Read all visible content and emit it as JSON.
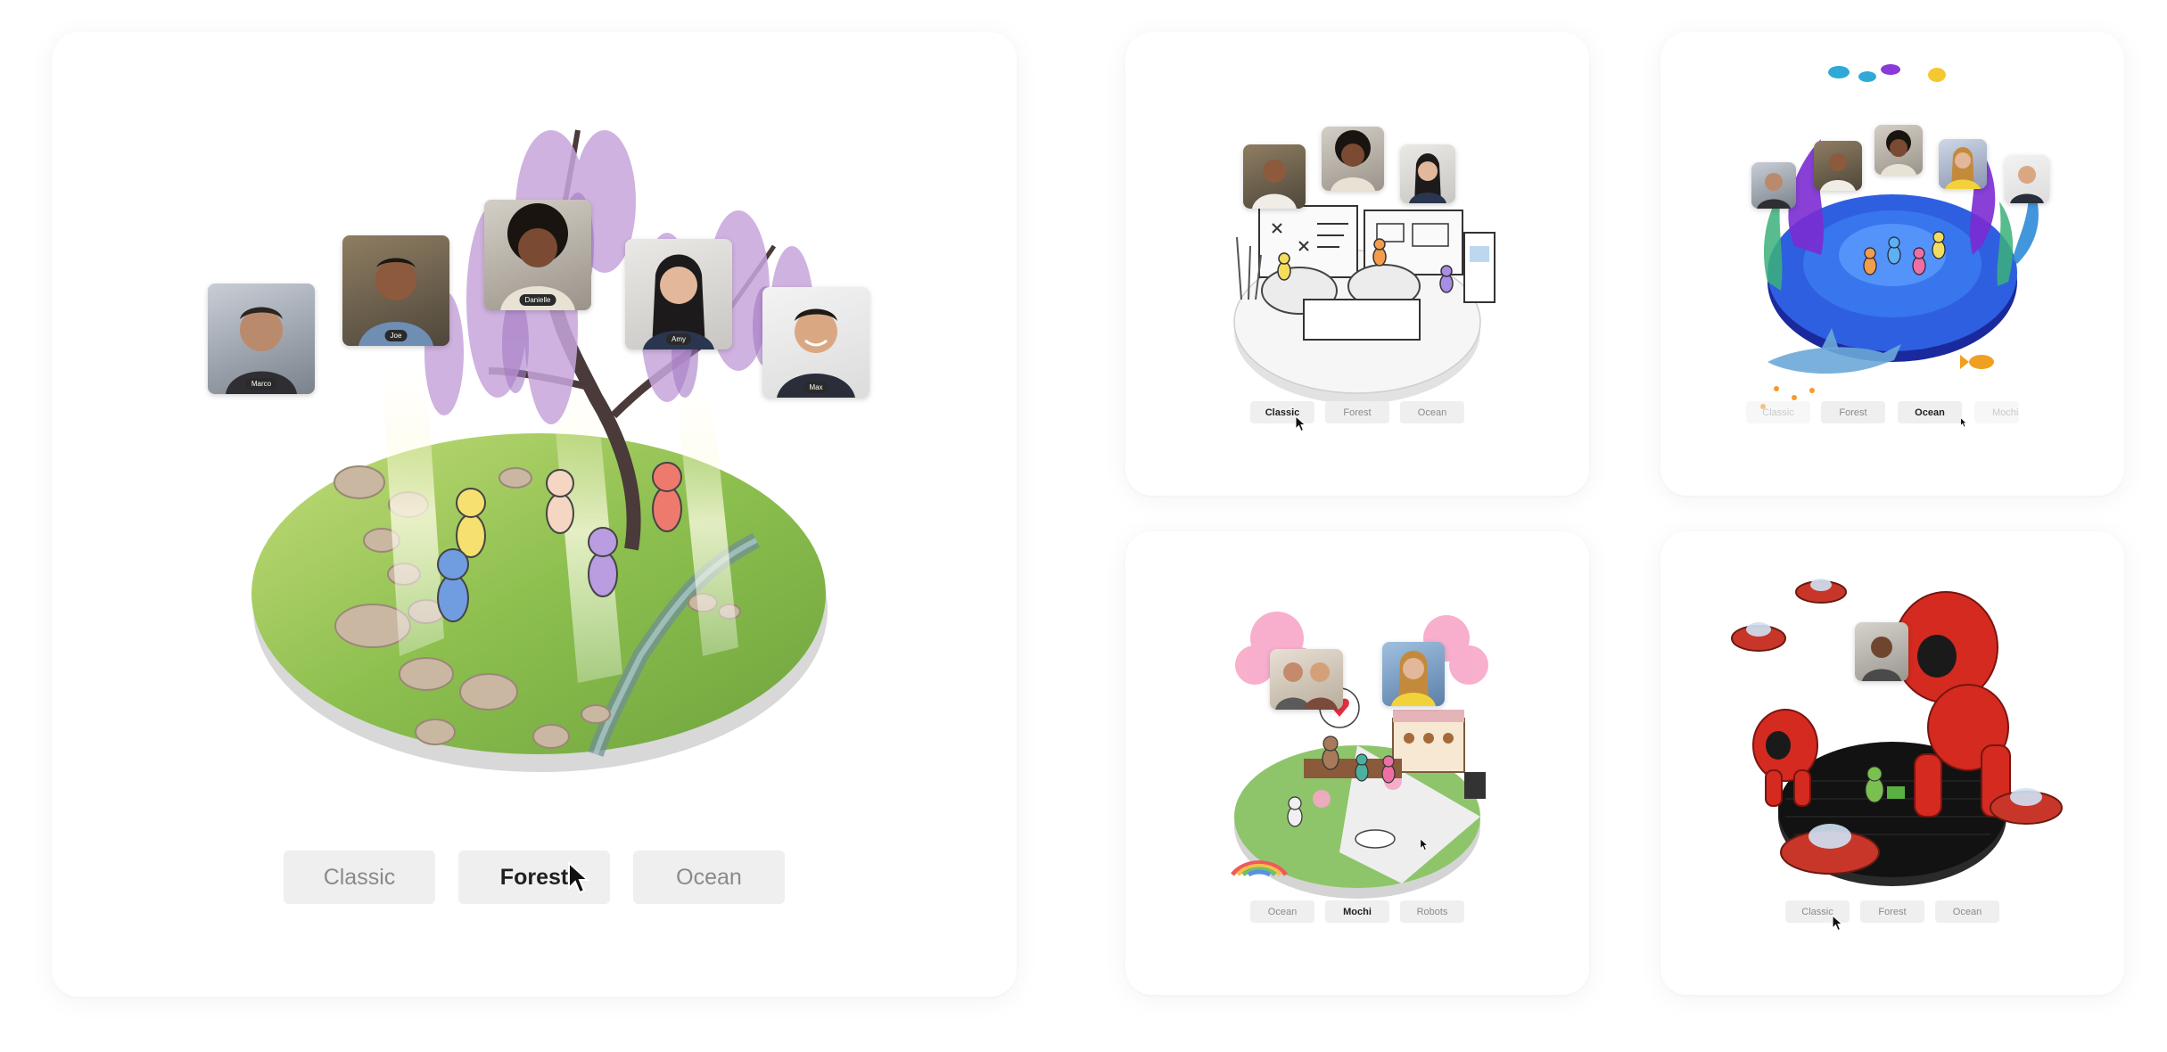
{
  "main_card": {
    "buttons": [
      {
        "label": "Classic",
        "active": false
      },
      {
        "label": "Forest",
        "active": true
      },
      {
        "label": "Ocean",
        "active": false
      }
    ],
    "participants": [
      "Marco",
      "Joe",
      "Danielle",
      "Amy",
      "Max"
    ]
  },
  "classic_card": {
    "buttons": [
      {
        "label": "Classic",
        "active": true
      },
      {
        "label": "Forest",
        "active": false
      },
      {
        "label": "Ocean",
        "active": false
      }
    ]
  },
  "ocean_card": {
    "buttons": [
      {
        "label": "Classic",
        "active": false
      },
      {
        "label": "Forest",
        "active": false
      },
      {
        "label": "Ocean",
        "active": true
      },
      {
        "label": "Mochi",
        "active": false
      }
    ]
  },
  "mochi_card": {
    "buttons": [
      {
        "label": "Ocean",
        "active": false
      },
      {
        "label": "Mochi",
        "active": true
      },
      {
        "label": "Robots",
        "active": false
      }
    ]
  },
  "robots_card": {
    "buttons": [
      {
        "label": "Classic",
        "active": false
      },
      {
        "label": "Forest",
        "active": false
      },
      {
        "label": "Ocean",
        "active": false
      }
    ]
  },
  "colors": {
    "card_bg": "#ffffff",
    "button_bg": "#efefef",
    "active_text": "#1f1f1f",
    "inactive_text": "#8a8a8a",
    "forest_green": "#7fb04a",
    "ocean_blue": "#2e5fe0",
    "robot_red": "#d42a20"
  },
  "icons": [
    "cursor-arrow-icon"
  ]
}
